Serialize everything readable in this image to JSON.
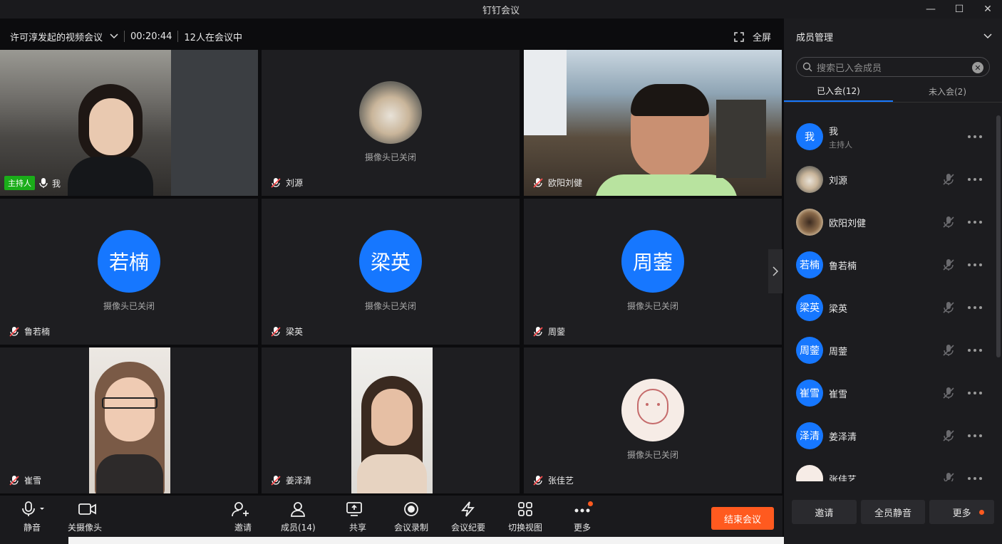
{
  "window": {
    "title": "钉钉会议"
  },
  "meeting": {
    "title": "许可淳发起的视频会议",
    "duration": "00:20:44",
    "count_text": "12人在会议中",
    "fullscreen_label": "全屏"
  },
  "tiles": [
    {
      "name": "我",
      "host_label": "主持人",
      "video": true
    },
    {
      "name": "刘源",
      "cam_off": "摄像头已关闭"
    },
    {
      "name": "欧阳刘健",
      "video": true
    },
    {
      "name": "鲁若楠",
      "avatar": "若楠",
      "cam_off": "摄像头已关闭"
    },
    {
      "name": "梁英",
      "avatar": "梁英",
      "cam_off": "摄像头已关闭"
    },
    {
      "name": "周蓥",
      "avatar": "周蓥",
      "cam_off": "摄像头已关闭"
    },
    {
      "name": "崔雪",
      "video": true
    },
    {
      "name": "姜泽清",
      "video": true
    },
    {
      "name": "张佳艺",
      "cam_off": "摄像头已关闭"
    }
  ],
  "toolbar": {
    "mute": "静音",
    "camera": "关摄像头",
    "invite": "邀请",
    "members": "成员(14)",
    "share": "共享",
    "record": "会议录制",
    "minutes": "会议纪要",
    "view": "切换视图",
    "more": "更多",
    "end": "结束会议"
  },
  "panel": {
    "title": "成员管理",
    "search_placeholder": "搜索已入会成员",
    "tab_joined": "已入会(12)",
    "tab_not_joined": "未入会(2)",
    "members": [
      {
        "name": "我",
        "avatar": "我",
        "role": "主持人"
      },
      {
        "name": "刘源",
        "avatar": ""
      },
      {
        "name": "欧阳刘健",
        "avatar": ""
      },
      {
        "name": "鲁若楠",
        "avatar": "若楠"
      },
      {
        "name": "梁英",
        "avatar": "梁英"
      },
      {
        "name": "周蓥",
        "avatar": "周蓥"
      },
      {
        "name": "崔雪",
        "avatar": "崔雪"
      },
      {
        "name": "姜泽清",
        "avatar": "泽清"
      },
      {
        "name": "张佳艺",
        "avatar": ""
      }
    ],
    "footer": {
      "invite": "邀请",
      "mute_all": "全员静音",
      "more": "更多"
    }
  },
  "colors": {
    "accent": "#1677ff",
    "end": "#ff5a1f",
    "host": "#1aad19"
  }
}
